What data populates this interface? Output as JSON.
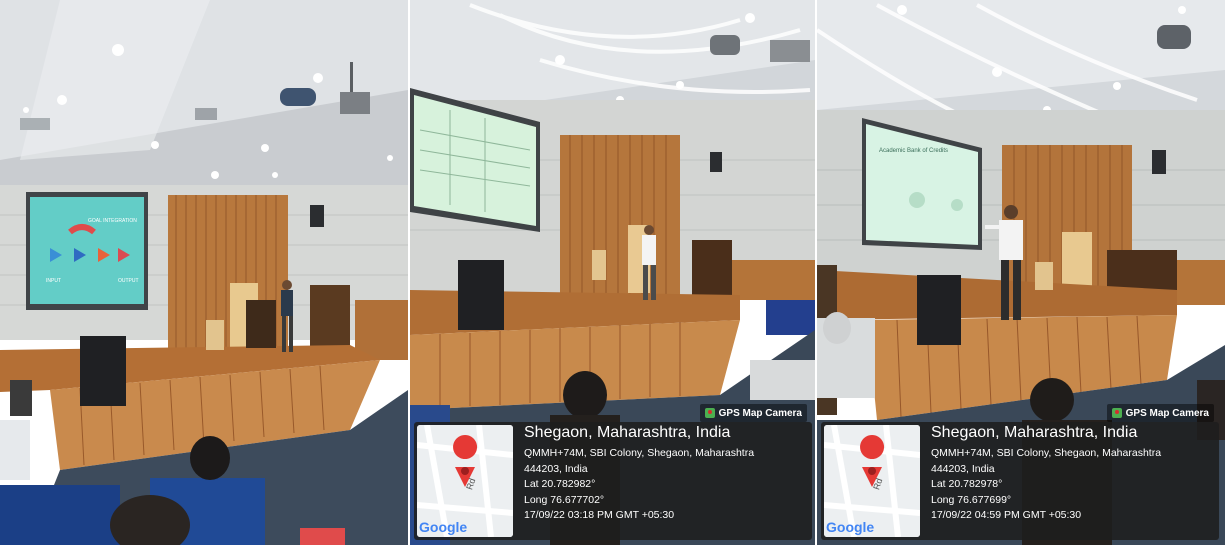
{
  "panels": [
    {
      "id": "left"
    },
    {
      "id": "middle",
      "gps": {
        "badge": "GPS Map Camera",
        "place": "Shegaon, Maharashtra, India",
        "address": "QMMH+74M, SBI Colony, Shegaon, Maharashtra",
        "postal": "444203, India",
        "lat": "Lat 20.782982°",
        "long": "Long 76.677702°",
        "timestamp": "17/09/22 03:18 PM GMT +05:30",
        "map_road": "Rd",
        "map_brand": "Google"
      }
    },
    {
      "id": "right",
      "gps": {
        "badge": "GPS Map Camera",
        "place": "Shegaon, Maharashtra, India",
        "address": "QMMH+74M, SBI Colony, Shegaon, Maharashtra",
        "postal": "444203, India",
        "lat": "Lat 20.782978°",
        "long": "Long 76.677699°",
        "timestamp": "17/09/22 04:59 PM GMT +05:30",
        "map_road": "Rd",
        "map_brand": "Google"
      }
    }
  ],
  "slide_left": {
    "goal": "GOAL INTEGRATION",
    "input": "INPUT",
    "output": "OUTPUT"
  },
  "slide_right": {
    "title": "Academic Bank of Credits"
  },
  "colors": {
    "stage_wood": "#a8632c",
    "carpet": "#3b4a5e",
    "wall": "#d9dbd9",
    "overlay_bg": "#1e1e1e",
    "map_pin": "#e53935"
  }
}
